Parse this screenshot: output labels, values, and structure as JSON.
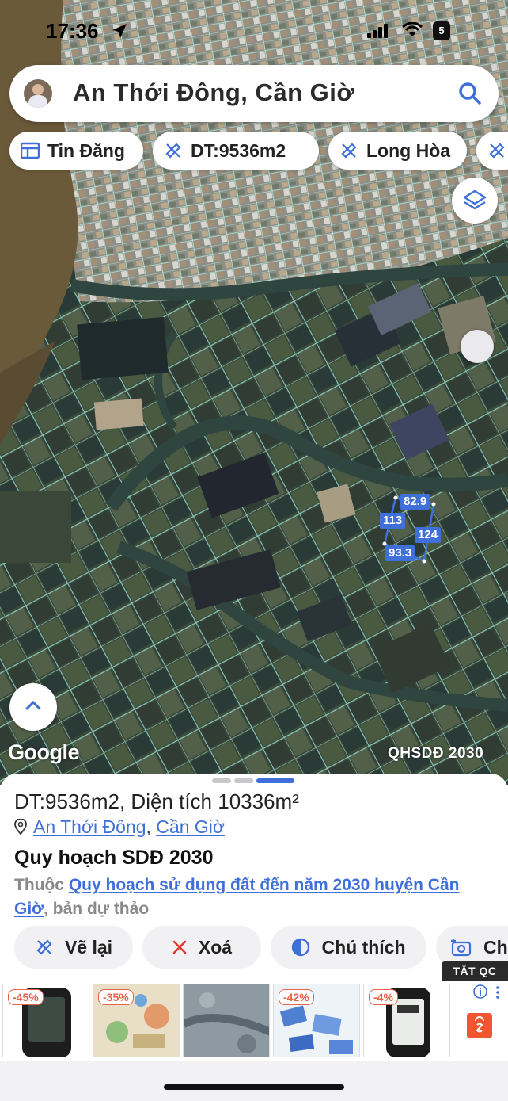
{
  "status_bar": {
    "time": "17:36",
    "battery": "5"
  },
  "search": {
    "title": "An Thới Đông, Cần Giờ"
  },
  "chips": [
    {
      "label": "Tin Đăng",
      "icon": "table-icon"
    },
    {
      "label": "DT:9536m2",
      "icon": "ruler-pencil-icon"
    },
    {
      "label": "Long Hòa",
      "icon": "ruler-pencil-icon"
    }
  ],
  "map": {
    "attribution": "Google",
    "plan_layer": "QHSDĐ 2030",
    "edge_lengths": [
      "82.9",
      "113",
      "124",
      "93.3"
    ]
  },
  "sheet": {
    "title_bold": "DT:9536m2",
    "title_rest": ", Diện tích 10336m²",
    "address_part1": "An Thới Đông",
    "address_separator": ",",
    "address_part2": "Cần Giờ",
    "plan_title": "Quy hoạch SDĐ 2030",
    "desc_prefix": "Thuộc ",
    "desc_link": "Quy hoạch sử dụng đất đến năm 2030 huyện Cần Giờ",
    "desc_suffix": ", bản dự thảo",
    "actions": [
      {
        "label": "Vẽ lại",
        "icon": "ruler-pencil-icon"
      },
      {
        "label": "Xoá",
        "icon": "close-icon"
      },
      {
        "label": "Chú thích",
        "icon": "contrast-icon"
      },
      {
        "label": "Ch",
        "icon": "camera-add-icon"
      }
    ]
  },
  "ads": {
    "close_label": "TẮT QC",
    "items": [
      {
        "discount": "-45%"
      },
      {
        "discount": "-35%"
      },
      {
        "discount": ""
      },
      {
        "discount": "-42%"
      },
      {
        "discount": "-4%"
      }
    ]
  },
  "colors": {
    "accent": "#3f6fd9",
    "map_lines": "#a8f0e8",
    "ad_discount": "#e8634a",
    "shop": "#f0562f"
  }
}
